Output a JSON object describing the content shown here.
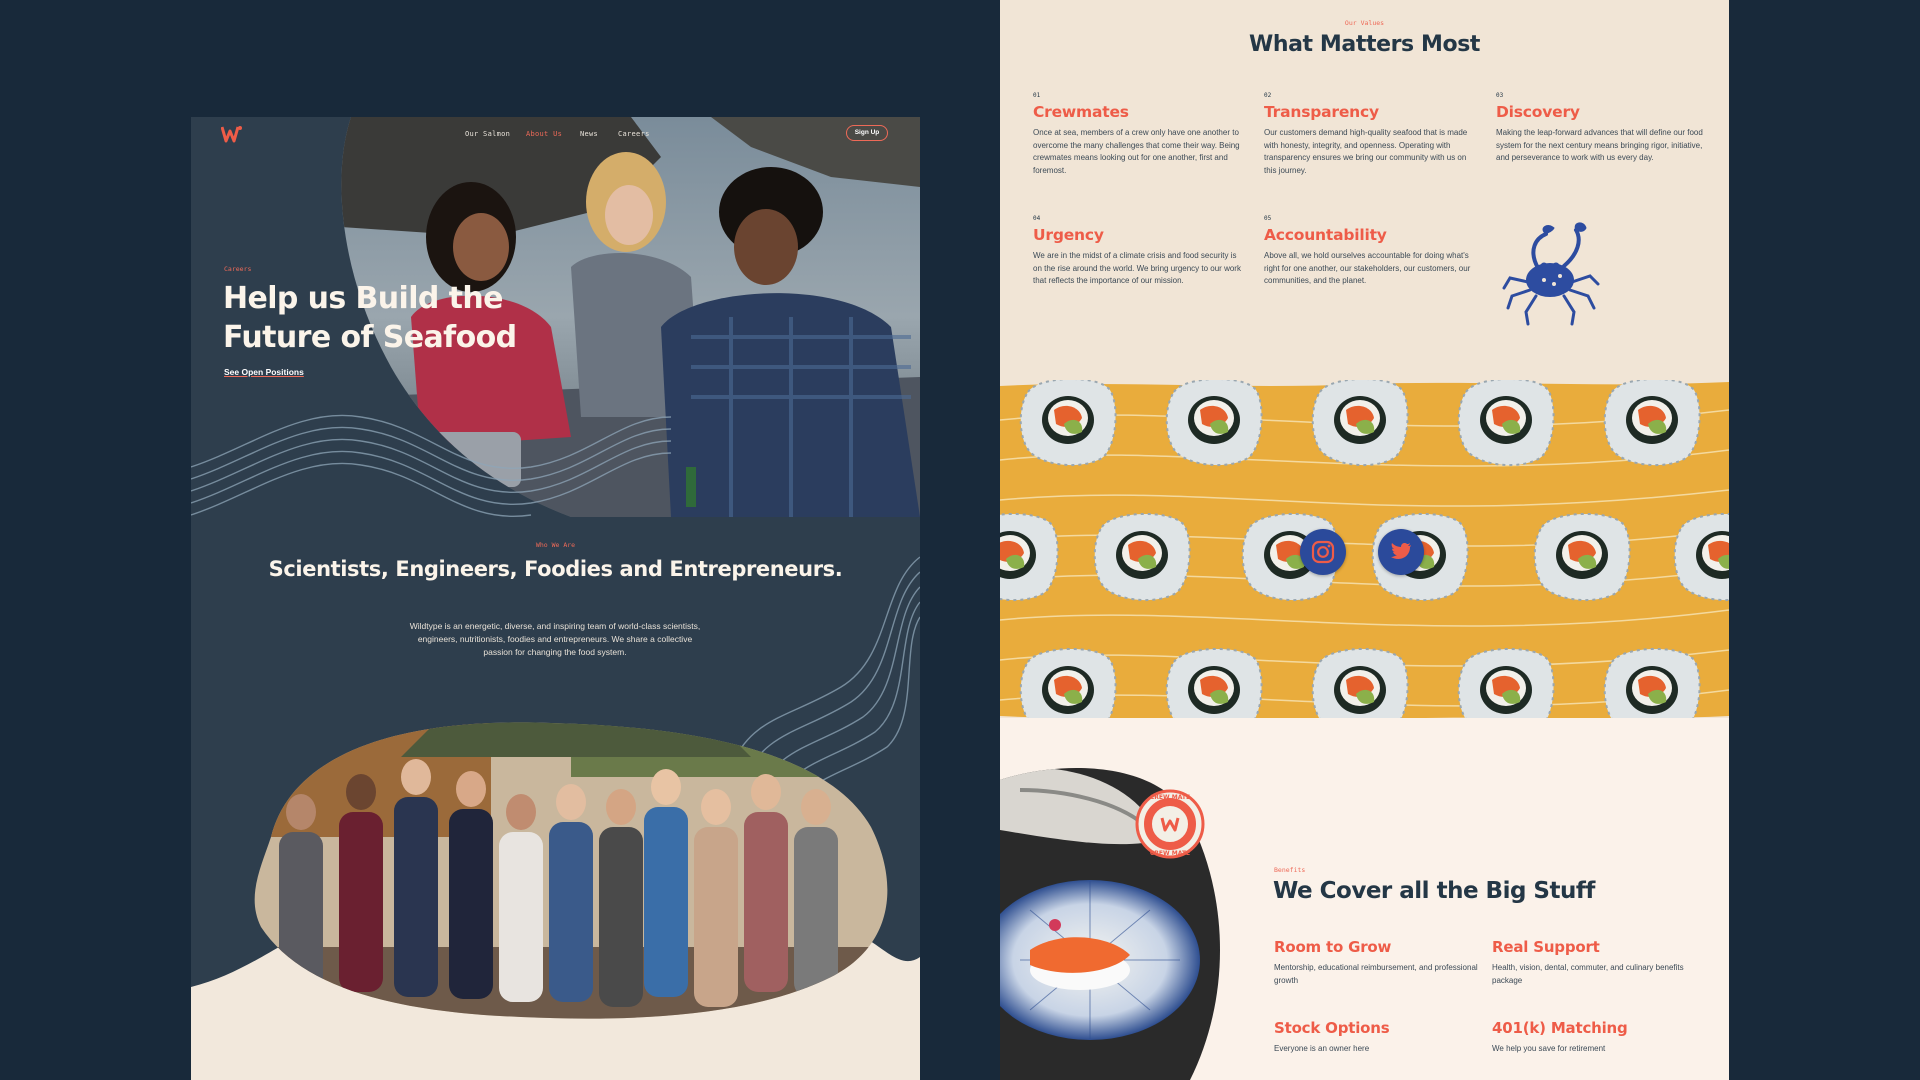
{
  "colors": {
    "page_background": "#18293a",
    "left_panel_background": "#2e3e4d",
    "right_panel_background": "#f1e5d6",
    "accent_coral": "#ee5c48",
    "heading_navy": "#243746",
    "sushi_band_yellow": "#e9ac3c",
    "social_button_blue": "#2b4a9b"
  },
  "left_page": {
    "logo_icon": "wildtype-w-logo-icon",
    "nav": {
      "items": [
        {
          "label": "Our Salmon"
        },
        {
          "label": "About Us",
          "active": true
        },
        {
          "label": "News"
        },
        {
          "label": "Careers"
        }
      ],
      "signup_label": "Sign Up"
    },
    "hero": {
      "eyebrow": "Careers",
      "title": "Help us Build the Future of Seafood",
      "link": "See Open Positions"
    },
    "who": {
      "eyebrow": "Who We Are",
      "title": "Scientists, Engineers, Foodies and Entrepreneurs.",
      "body": "Wildtype is an energetic, diverse, and inspiring team of world-class scientists, engineers, nutritionists, foodies and entrepreneurs. We share a collective passion for changing the food system."
    }
  },
  "right_page": {
    "values": {
      "eyebrow": "Our Values",
      "title": "What Matters Most",
      "items": [
        {
          "num": "01",
          "title": "Crewmates",
          "body": "Once at sea, members of a crew only have one another to overcome the many challenges that come their way. Being crewmates means looking out for one another, first and foremost."
        },
        {
          "num": "02",
          "title": "Transparency",
          "body": "Our customers demand high-quality seafood that is made with honesty, integrity, and openness. Operating with transparency ensures we bring our community with us on this journey."
        },
        {
          "num": "03",
          "title": "Discovery",
          "body": "Making the leap-forward advances that will define our food system for the next century means bringing rigor, initiative, and perseverance to work with us every day."
        },
        {
          "num": "04",
          "title": "Urgency",
          "body": "We are in the midst of a climate crisis and food security is on the rise around the world. We bring urgency to our work that reflects the importance of our mission."
        },
        {
          "num": "05",
          "title": "Accountability",
          "body": "Above all, we hold ourselves accountable for doing what's right for one another, our stakeholders, our customers, our communities, and the planet."
        }
      ],
      "illustration_icon": "crab-icon"
    },
    "social": [
      {
        "name": "instagram-icon"
      },
      {
        "name": "twitter-icon"
      }
    ],
    "badge": {
      "top_text": "CREW MATE",
      "bottom_text": "CREW MATE"
    },
    "benefits": {
      "eyebrow": "Benefits",
      "title": "We Cover all the Big Stuff",
      "items": [
        {
          "title": "Room to Grow",
          "body": "Mentorship, educational reimbursement, and professional growth"
        },
        {
          "title": "Real Support",
          "body": "Health, vision, dental, commuter, and culinary benefits package"
        },
        {
          "title": "Stock Options",
          "body": "Everyone is an owner here"
        },
        {
          "title": "401(k) Matching",
          "body": "We help you save for retirement"
        }
      ]
    }
  }
}
